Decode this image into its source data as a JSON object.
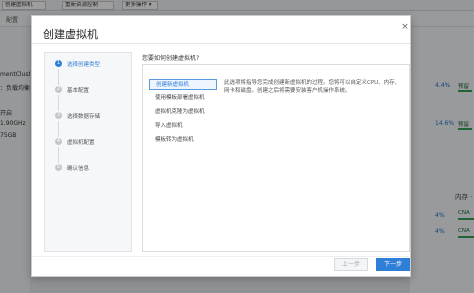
{
  "background": {
    "toolbar_buttons": [
      "创建虚拟机",
      "重新资源控制",
      "更多操作 ▾"
    ],
    "subtab": "配置",
    "left_items": [
      "mentCluster",
      "：负载均衡",
      "开启",
      "1.90GHz",
      "75GB"
    ],
    "right_percents": [
      "4.4%",
      "14.6%",
      "4%",
      "4%"
    ],
    "right_labels": [
      "预留",
      "预留",
      "CNA",
      "CNA"
    ],
    "right_header": "内存 ·"
  },
  "modal": {
    "title": "创建虚拟机",
    "close_icon": "×",
    "steps": [
      {
        "num": "1",
        "label": "选择创建类型"
      },
      {
        "num": "2",
        "label": "基本配置"
      },
      {
        "num": "3",
        "label": "选择数据存储"
      },
      {
        "num": "4",
        "label": "虚拟机配置"
      },
      {
        "num": "5",
        "label": "确认信息"
      }
    ],
    "question": "您要如何创建虚拟机?",
    "options": [
      "创建新虚拟机",
      "使用模板部署虚拟机",
      "虚拟机克隆为虚拟机",
      "导入虚拟机",
      "模板转为虚拟机"
    ],
    "description": "此选项将指导您完成创建新虚拟机的过程。您将可以自定义CPU、内存、网卡和磁盘。创建之后将需要安装客户机操作系统。",
    "prev_label": "上一步",
    "next_label": "下一步"
  }
}
